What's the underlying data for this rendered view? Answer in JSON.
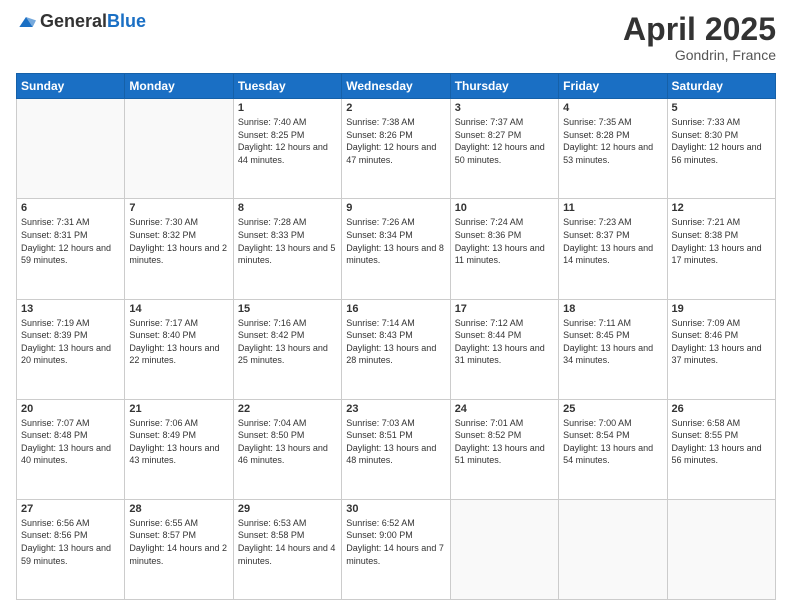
{
  "logo": {
    "general": "General",
    "blue": "Blue"
  },
  "title": "April 2025",
  "location": "Gondrin, France",
  "weekdays": [
    "Sunday",
    "Monday",
    "Tuesday",
    "Wednesday",
    "Thursday",
    "Friday",
    "Saturday"
  ],
  "weeks": [
    [
      {
        "day": "",
        "info": ""
      },
      {
        "day": "",
        "info": ""
      },
      {
        "day": "1",
        "info": "Sunrise: 7:40 AM\nSunset: 8:25 PM\nDaylight: 12 hours and 44 minutes."
      },
      {
        "day": "2",
        "info": "Sunrise: 7:38 AM\nSunset: 8:26 PM\nDaylight: 12 hours and 47 minutes."
      },
      {
        "day": "3",
        "info": "Sunrise: 7:37 AM\nSunset: 8:27 PM\nDaylight: 12 hours and 50 minutes."
      },
      {
        "day": "4",
        "info": "Sunrise: 7:35 AM\nSunset: 8:28 PM\nDaylight: 12 hours and 53 minutes."
      },
      {
        "day": "5",
        "info": "Sunrise: 7:33 AM\nSunset: 8:30 PM\nDaylight: 12 hours and 56 minutes."
      }
    ],
    [
      {
        "day": "6",
        "info": "Sunrise: 7:31 AM\nSunset: 8:31 PM\nDaylight: 12 hours and 59 minutes."
      },
      {
        "day": "7",
        "info": "Sunrise: 7:30 AM\nSunset: 8:32 PM\nDaylight: 13 hours and 2 minutes."
      },
      {
        "day": "8",
        "info": "Sunrise: 7:28 AM\nSunset: 8:33 PM\nDaylight: 13 hours and 5 minutes."
      },
      {
        "day": "9",
        "info": "Sunrise: 7:26 AM\nSunset: 8:34 PM\nDaylight: 13 hours and 8 minutes."
      },
      {
        "day": "10",
        "info": "Sunrise: 7:24 AM\nSunset: 8:36 PM\nDaylight: 13 hours and 11 minutes."
      },
      {
        "day": "11",
        "info": "Sunrise: 7:23 AM\nSunset: 8:37 PM\nDaylight: 13 hours and 14 minutes."
      },
      {
        "day": "12",
        "info": "Sunrise: 7:21 AM\nSunset: 8:38 PM\nDaylight: 13 hours and 17 minutes."
      }
    ],
    [
      {
        "day": "13",
        "info": "Sunrise: 7:19 AM\nSunset: 8:39 PM\nDaylight: 13 hours and 20 minutes."
      },
      {
        "day": "14",
        "info": "Sunrise: 7:17 AM\nSunset: 8:40 PM\nDaylight: 13 hours and 22 minutes."
      },
      {
        "day": "15",
        "info": "Sunrise: 7:16 AM\nSunset: 8:42 PM\nDaylight: 13 hours and 25 minutes."
      },
      {
        "day": "16",
        "info": "Sunrise: 7:14 AM\nSunset: 8:43 PM\nDaylight: 13 hours and 28 minutes."
      },
      {
        "day": "17",
        "info": "Sunrise: 7:12 AM\nSunset: 8:44 PM\nDaylight: 13 hours and 31 minutes."
      },
      {
        "day": "18",
        "info": "Sunrise: 7:11 AM\nSunset: 8:45 PM\nDaylight: 13 hours and 34 minutes."
      },
      {
        "day": "19",
        "info": "Sunrise: 7:09 AM\nSunset: 8:46 PM\nDaylight: 13 hours and 37 minutes."
      }
    ],
    [
      {
        "day": "20",
        "info": "Sunrise: 7:07 AM\nSunset: 8:48 PM\nDaylight: 13 hours and 40 minutes."
      },
      {
        "day": "21",
        "info": "Sunrise: 7:06 AM\nSunset: 8:49 PM\nDaylight: 13 hours and 43 minutes."
      },
      {
        "day": "22",
        "info": "Sunrise: 7:04 AM\nSunset: 8:50 PM\nDaylight: 13 hours and 46 minutes."
      },
      {
        "day": "23",
        "info": "Sunrise: 7:03 AM\nSunset: 8:51 PM\nDaylight: 13 hours and 48 minutes."
      },
      {
        "day": "24",
        "info": "Sunrise: 7:01 AM\nSunset: 8:52 PM\nDaylight: 13 hours and 51 minutes."
      },
      {
        "day": "25",
        "info": "Sunrise: 7:00 AM\nSunset: 8:54 PM\nDaylight: 13 hours and 54 minutes."
      },
      {
        "day": "26",
        "info": "Sunrise: 6:58 AM\nSunset: 8:55 PM\nDaylight: 13 hours and 56 minutes."
      }
    ],
    [
      {
        "day": "27",
        "info": "Sunrise: 6:56 AM\nSunset: 8:56 PM\nDaylight: 13 hours and 59 minutes."
      },
      {
        "day": "28",
        "info": "Sunrise: 6:55 AM\nSunset: 8:57 PM\nDaylight: 14 hours and 2 minutes."
      },
      {
        "day": "29",
        "info": "Sunrise: 6:53 AM\nSunset: 8:58 PM\nDaylight: 14 hours and 4 minutes."
      },
      {
        "day": "30",
        "info": "Sunrise: 6:52 AM\nSunset: 9:00 PM\nDaylight: 14 hours and 7 minutes."
      },
      {
        "day": "",
        "info": ""
      },
      {
        "day": "",
        "info": ""
      },
      {
        "day": "",
        "info": ""
      }
    ]
  ]
}
